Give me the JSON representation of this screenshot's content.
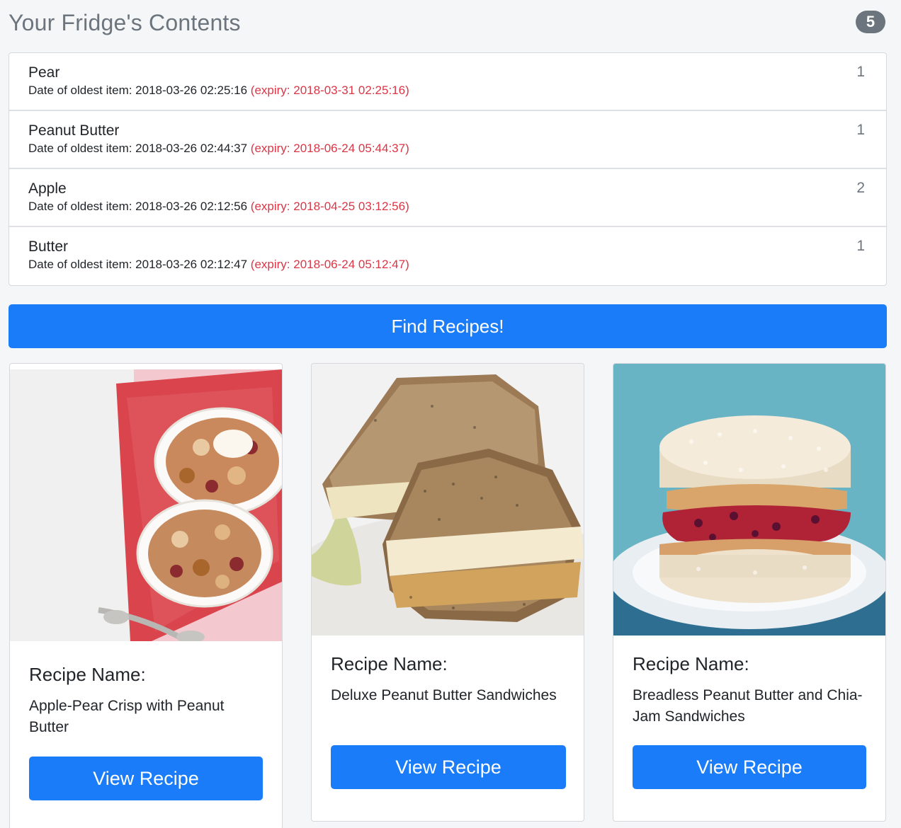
{
  "header": {
    "title": "Your Fridge's Contents",
    "item_count": "5"
  },
  "fridge_items": [
    {
      "name": "Pear",
      "meta": "Date of oldest item: 2018-03-26 02:25:16",
      "expiry": "(expiry: 2018-03-31 02:25:16)",
      "quantity": "1"
    },
    {
      "name": "Peanut Butter",
      "meta": "Date of oldest item: 2018-03-26 02:44:37",
      "expiry": "(expiry: 2018-06-24 05:44:37)",
      "quantity": "1"
    },
    {
      "name": "Apple",
      "meta": "Date of oldest item: 2018-03-26 02:12:56",
      "expiry": "(expiry: 2018-04-25 03:12:56)",
      "quantity": "2"
    },
    {
      "name": "Butter",
      "meta": "Date of oldest item: 2018-03-26 02:12:47",
      "expiry": "(expiry: 2018-06-24 05:12:47)",
      "quantity": "1"
    }
  ],
  "find_button": {
    "label": "Find Recipes!"
  },
  "recipes": [
    {
      "heading": "Recipe Name:",
      "name": "Apple-Pear Crisp with Peanut Butter",
      "button": "View Recipe",
      "photo_icon": "apple-pear-crisp-photo"
    },
    {
      "heading": "Recipe Name:",
      "name": "Deluxe Peanut Butter Sandwiches",
      "button": "View Recipe",
      "photo_icon": "peanut-butter-sandwich-photo"
    },
    {
      "heading": "Recipe Name:",
      "name": "Breadless Peanut Butter and Chia-Jam Sandwiches",
      "button": "View Recipe",
      "photo_icon": "rice-cake-sandwich-photo"
    }
  ],
  "colors": {
    "primary": "#1a7cf8",
    "expiry": "#dc3545",
    "muted": "#6c757d"
  }
}
